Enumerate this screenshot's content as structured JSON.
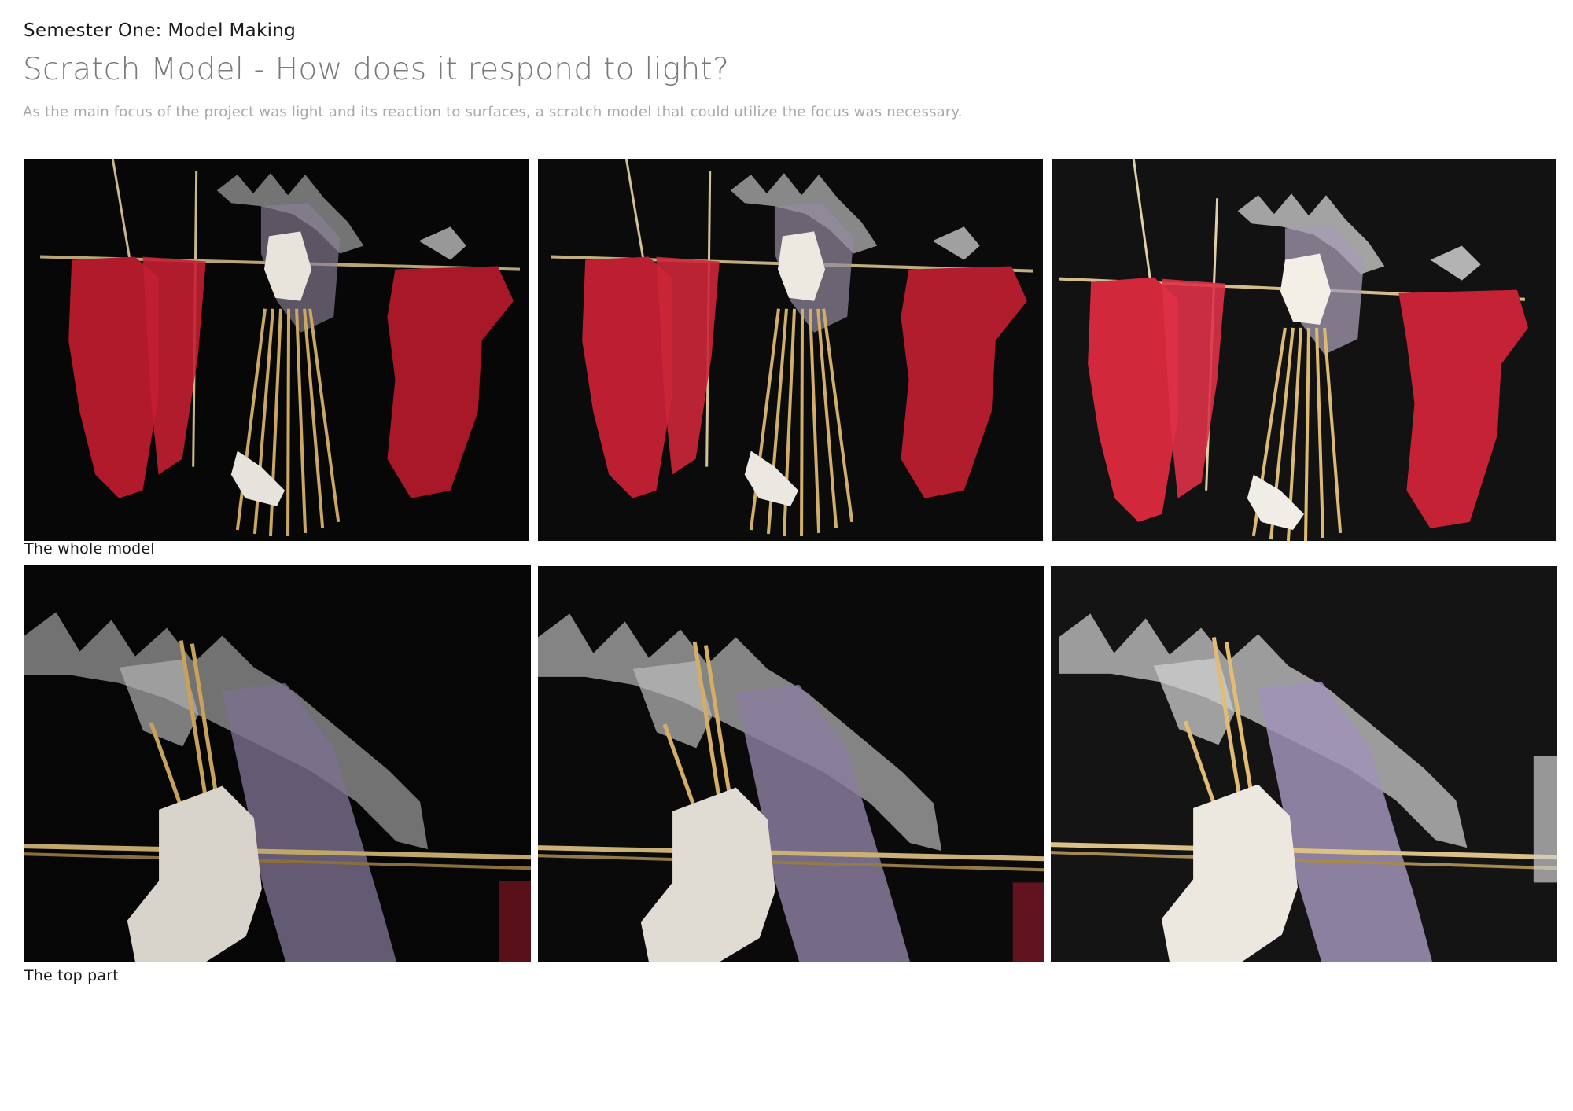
{
  "header": {
    "kicker": "Semester One: Model Making",
    "title": "Scratch Model - How does it respond to light?",
    "intro": "As the main focus of the project was light and its reaction to surfaces, a scratch model that could utilize the focus was necessary."
  },
  "rows": [
    {
      "caption": "The whole model"
    },
    {
      "caption": "The top part"
    }
  ]
}
